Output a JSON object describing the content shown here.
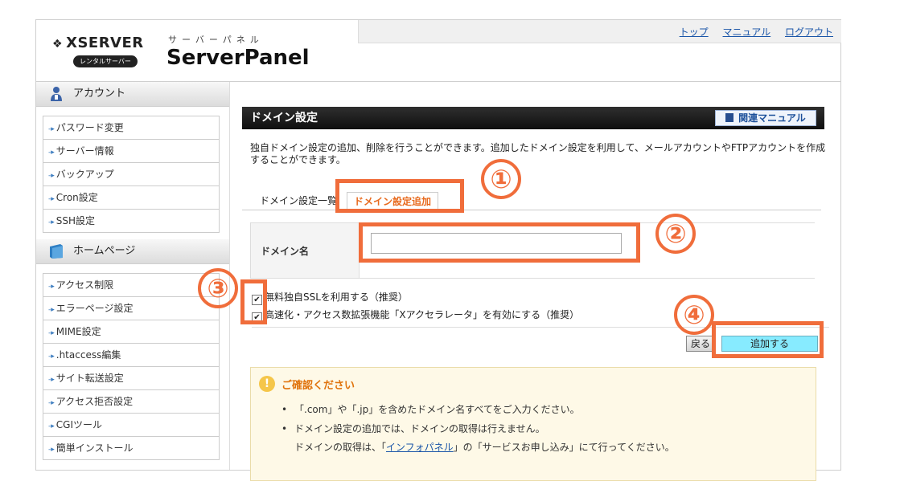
{
  "header": {
    "brand": "XSERVER",
    "brand_sub": "レンタルサーバー",
    "kana": "サーバーパネル",
    "title": "ServerPanel",
    "links": [
      "トップ",
      "マニュアル",
      "ログアウト"
    ]
  },
  "sidebar": {
    "sections": [
      {
        "title": "アカウント",
        "icon": "person-icon",
        "items": [
          "パスワード変更",
          "サーバー情報",
          "バックアップ",
          "Cron設定",
          "SSH設定"
        ]
      },
      {
        "title": "ホームページ",
        "icon": "book-icon",
        "items": [
          "アクセス制限",
          "エラーページ設定",
          "MIME設定",
          ".htaccess編集",
          "サイト転送設定",
          "アクセス拒否設定",
          "CGIツール",
          "簡単インストール"
        ]
      }
    ]
  },
  "main": {
    "title": "ドメイン設定",
    "manual_button": "関連マニュアル",
    "description": "独自ドメイン設定の追加、削除を行うことができます。追加したドメイン設定を利用して、メールアカウントやFTPアカウントを作成することができます。",
    "tabs": [
      "ドメイン設定一覧",
      "ドメイン設定追加"
    ],
    "active_tab": "ドメイン設定追加",
    "form": {
      "domain_label": "ドメイン名",
      "domain_value": "",
      "checkbox_ssl": "無料独自SSLを利用する（推奨）",
      "checkbox_accel": "高速化・アクセス数拡張機能「Xアクセラレータ」を有効にする（推奨）",
      "ssl_checked": true,
      "accel_checked": true
    },
    "back_button": "戻る",
    "submit_button": "追加する"
  },
  "notice": {
    "title": "ご確認ください",
    "item1": "「.com」や「.jp」を含めたドメイン名すべてをご入力ください。",
    "item2": "ドメイン設定の追加では、ドメインの取得は行えません。",
    "item2_sub_before": "ドメインの取得は、「",
    "item2_link": "インフォパネル",
    "item2_sub_after": "」の「サービスお申し込み」にて行ってください。"
  },
  "annotations": {
    "steps": [
      "①",
      "②",
      "③",
      "④"
    ],
    "color": "#f06d3b"
  },
  "colors": {
    "accent_orange": "#e86a1e",
    "submit_bg": "#87ebff",
    "link_blue": "#1a55a8"
  }
}
